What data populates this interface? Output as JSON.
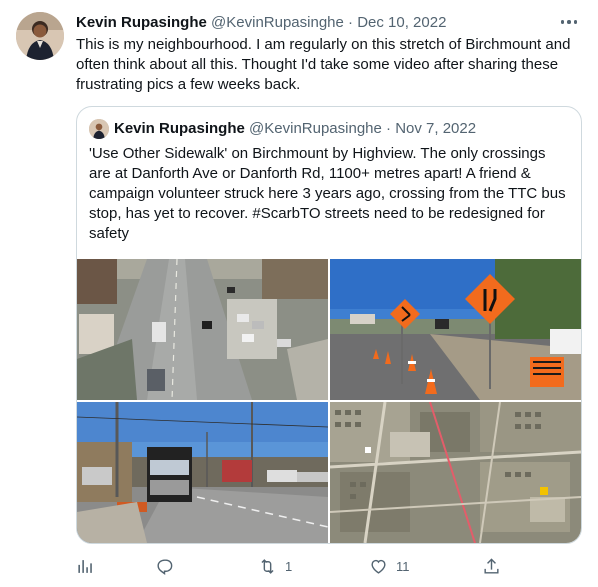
{
  "tweet": {
    "author_name": "Kevin Rupasinghe",
    "author_handle": "@KevinRupasinghe",
    "separator": "·",
    "date": "Dec 10, 2022",
    "text": "This is my neighbourhood. I am regularly on this stretch of Birchmount and often think about all this. Thought I'd take some video after sharing these frustrating pics a few weeks back."
  },
  "quoted": {
    "author_name": "Kevin Rupasinghe",
    "author_handle": "@KevinRupasinghe",
    "separator": "·",
    "date": "Nov 7, 2022",
    "text": "'Use Other Sidewalk' on Birchmount by Highview. The only crossings are at Danforth Ave or Danforth Rd, 1100+ metres apart! A friend & campaign volunteer struck here 3 years ago, crossing from the TTC bus stop, has yet to recover. #ScarbTO streets need to be redesigned for safety",
    "images": [
      {
        "name": "aerial-road-photo"
      },
      {
        "name": "road-signs-photo",
        "sign_text": "PEDESTRIANS PLEASE USE OTHER SIDEWALK"
      },
      {
        "name": "street-truck-photo"
      },
      {
        "name": "satellite-map-photo"
      }
    ]
  },
  "actions": {
    "views_icon": "analytics-icon",
    "reply_icon": "reply-icon",
    "retweet_icon": "retweet-icon",
    "retweet_count": "1",
    "like_icon": "heart-icon",
    "like_count": "11",
    "share_icon": "share-icon"
  },
  "colors": {
    "text": "#0f1419",
    "secondary": "#536471",
    "border": "#cfd9de",
    "sign_orange": "#f26b1d"
  }
}
